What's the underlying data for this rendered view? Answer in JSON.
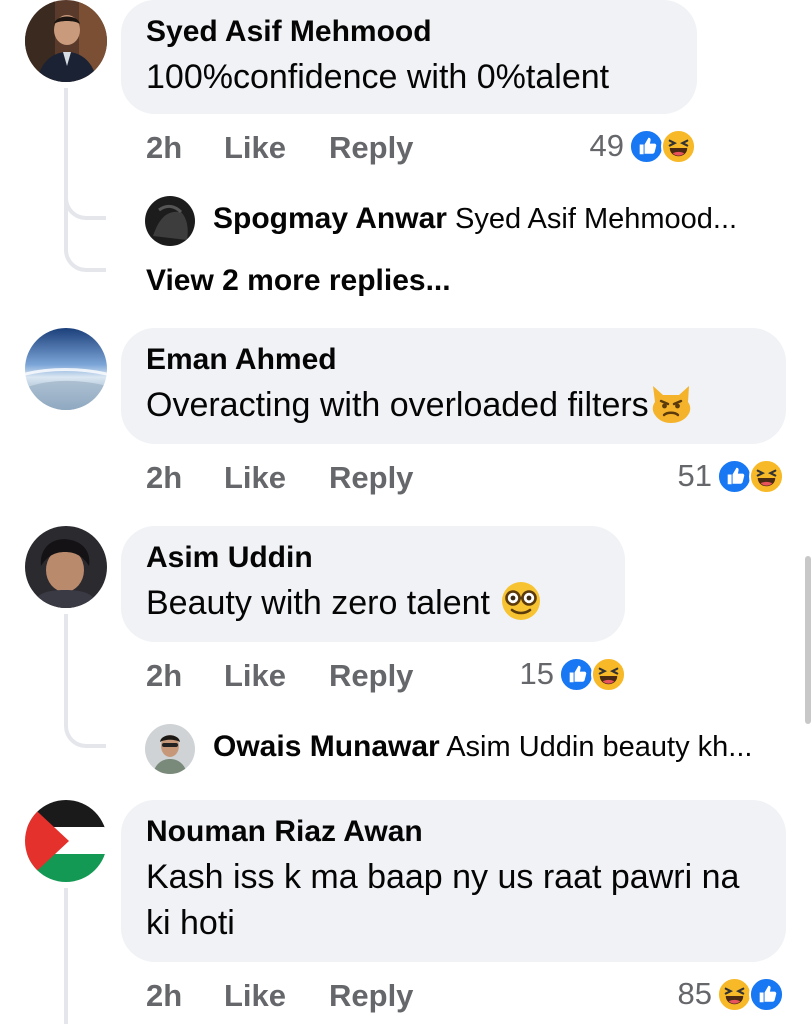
{
  "comments": [
    {
      "name": "Syed Asif Mehmood",
      "text": "100%confidence with 0%talent",
      "time": "2h",
      "like": "Like",
      "reply": "Reply",
      "reaction_count": "49",
      "reaction_icons": [
        "like-icon",
        "laugh-icon"
      ],
      "replies": [
        {
          "name": "Spogmay Anwar",
          "preview": "Syed Asif Mehmood..."
        }
      ],
      "more_replies": "View 2 more replies..."
    },
    {
      "name": "Eman Ahmed",
      "text": "Overacting with overloaded filters",
      "emoji": "angry-cat-emoji",
      "time": "2h",
      "like": "Like",
      "reply": "Reply",
      "reaction_count": "51",
      "reaction_icons": [
        "like-icon",
        "laugh-icon"
      ]
    },
    {
      "name": "Asim Uddin",
      "text": "Beauty with zero talent",
      "emoji": "nerd-face-emoji",
      "time": "2h",
      "like": "Like",
      "reply": "Reply",
      "reaction_count": "15",
      "reaction_icons": [
        "like-icon",
        "laugh-icon"
      ],
      "replies": [
        {
          "name": "Owais Munawar",
          "preview": "Asim Uddin beauty kh..."
        }
      ]
    },
    {
      "name": "Nouman Riaz Awan",
      "text": "Kash iss k ma baap ny us raat pawri na ki hoti",
      "time": "2h",
      "like": "Like",
      "reply": "Reply",
      "reaction_count": "85",
      "reaction_icons": [
        "laugh-icon",
        "like-icon"
      ]
    }
  ],
  "colors": {
    "bubble": "#f0f2f5",
    "secondary_text": "#65676b",
    "like_blue": "#1877f2",
    "laugh_yellow": "#f7b928"
  }
}
